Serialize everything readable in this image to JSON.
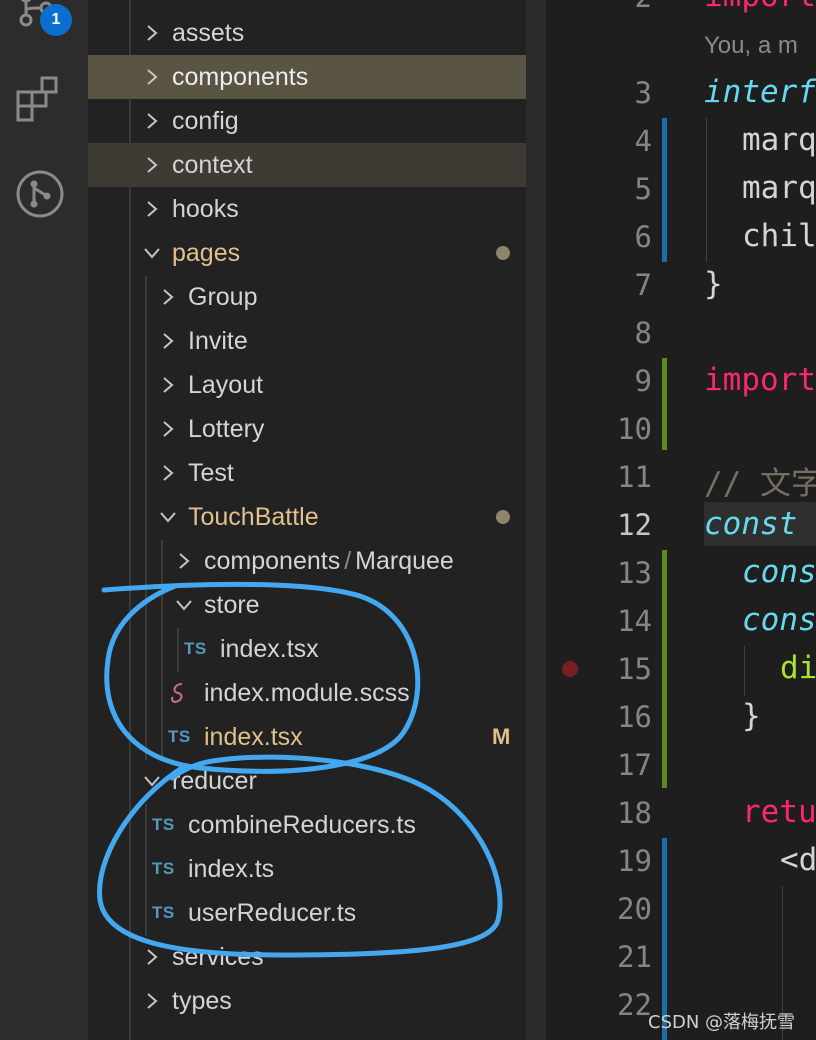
{
  "activity_bar": {
    "badge_count": "1",
    "icons": [
      "source-control-icon",
      "extensions-icon",
      "git-graph-icon"
    ]
  },
  "explorer": {
    "items": [
      {
        "label": "assets",
        "type": "folder",
        "state": "collapsed"
      },
      {
        "label": "components",
        "type": "folder",
        "state": "collapsed",
        "selected": true
      },
      {
        "label": "config",
        "type": "folder",
        "state": "collapsed"
      },
      {
        "label": "context",
        "type": "folder",
        "state": "collapsed",
        "hover": true
      },
      {
        "label": "hooks",
        "type": "folder",
        "state": "collapsed"
      },
      {
        "label": "pages",
        "type": "folder",
        "state": "expanded",
        "modified_dot": true
      },
      {
        "label": "Group",
        "type": "folder",
        "state": "collapsed"
      },
      {
        "label": "Invite",
        "type": "folder",
        "state": "collapsed"
      },
      {
        "label": "Layout",
        "type": "folder",
        "state": "collapsed"
      },
      {
        "label": "Lottery",
        "type": "folder",
        "state": "collapsed"
      },
      {
        "label": "Test",
        "type": "folder",
        "state": "collapsed"
      },
      {
        "label": "TouchBattle",
        "type": "folder",
        "state": "expanded",
        "modified_dot": true
      },
      {
        "label": "components",
        "label2": "Marquee",
        "type": "folder",
        "state": "collapsed"
      },
      {
        "label": "store",
        "type": "folder",
        "state": "expanded"
      },
      {
        "label": "index.tsx",
        "type": "ts-file",
        "badge": "TS"
      },
      {
        "label": "index.module.scss",
        "type": "scss-file"
      },
      {
        "label": "index.tsx",
        "type": "ts-file",
        "badge": "TS",
        "git_status": "M"
      },
      {
        "label": "reducer",
        "type": "folder",
        "state": "expanded"
      },
      {
        "label": "combineReducers.ts",
        "type": "ts-file",
        "badge": "TS"
      },
      {
        "label": "index.ts",
        "type": "ts-file",
        "badge": "TS"
      },
      {
        "label": "userReducer.ts",
        "type": "ts-file",
        "badge": "TS"
      },
      {
        "label": "services",
        "type": "folder",
        "state": "collapsed"
      },
      {
        "label": "types",
        "type": "folder",
        "state": "collapsed"
      }
    ]
  },
  "editor": {
    "inline_hint": "You, a m",
    "line_numbers": [
      "2",
      "3",
      "4",
      "5",
      "6",
      "7",
      "8",
      "9",
      "10",
      "11",
      "12",
      "13",
      "14",
      "15",
      "16",
      "17",
      "18",
      "19",
      "20",
      "21",
      "22"
    ],
    "active_line": "12",
    "lines": {
      "l2": "import",
      "l3": "interf",
      "l4": "marq",
      "l5": "marq",
      "l6": "chil",
      "l7": "}",
      "l9": "import",
      "l11": "// 文字",
      "l12": "const",
      "l13": "cons",
      "l14": "cons",
      "l15": "di",
      "l16": "}",
      "l18": "retu",
      "l19": "<d"
    }
  },
  "watermark": "CSDN @落梅抚雪"
}
